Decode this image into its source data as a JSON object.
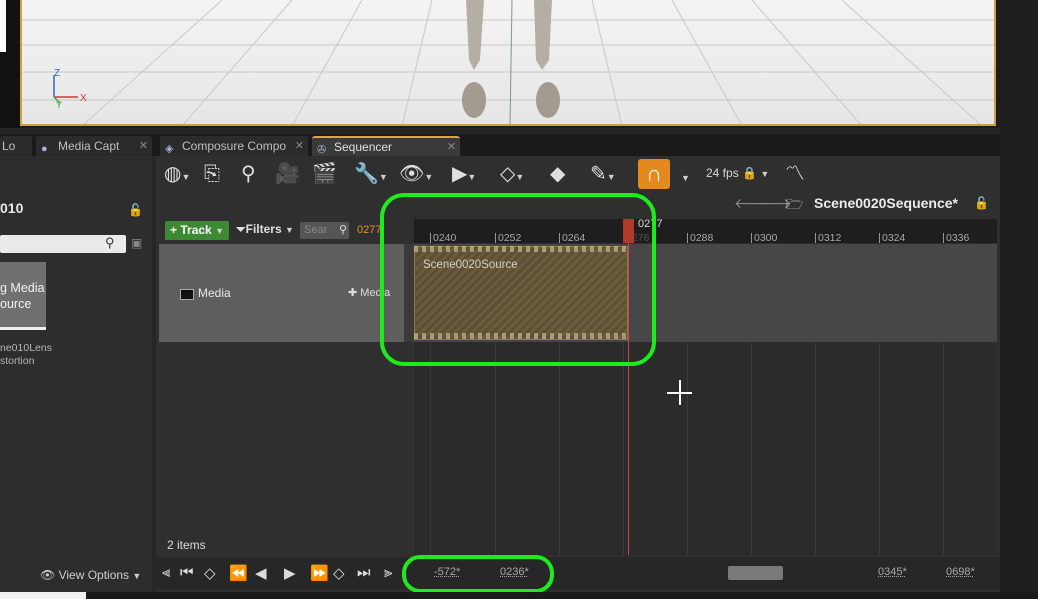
{
  "tabs": [
    {
      "label": "Lo",
      "icon": "log-icon"
    },
    {
      "label": "Media Capt",
      "icon": "media-capture-icon"
    },
    {
      "label": "Composure Compo",
      "icon": "composure-icon"
    },
    {
      "label": "Sequencer",
      "icon": "sequencer-icon",
      "active": true
    }
  ],
  "left_panel": {
    "title": "010",
    "thumb_label": "g Media\nource",
    "asset_name": "ne010Lens\nstortion",
    "view_options": "View Options"
  },
  "toolbar": {
    "fps": "24 fps",
    "sequence_name": "Scene0020Sequence*"
  },
  "tracks": {
    "add_track_label": "Track",
    "filters_label": "Filters",
    "search_placeholder": "Sear",
    "current_frame": "0277",
    "media_track_name": "Media",
    "add_media_label": "Media",
    "section_label": "Scene0020Source",
    "items_count": "2 items"
  },
  "ruler": {
    "playhead_label": "0277",
    "ticks": [
      "0240",
      "0252",
      "0264",
      "0276",
      "0288",
      "0300",
      "0312",
      "0324",
      "0336"
    ]
  },
  "playback": {
    "range_start": "-572*",
    "range_end": "0236*",
    "view_start": "0345*",
    "view_end": "0698*"
  },
  "colors": {
    "highlight": "#1eea1e",
    "track_button": "#3d8a34",
    "snap_button": "#e38a1e",
    "playhead": "#b0392c"
  }
}
